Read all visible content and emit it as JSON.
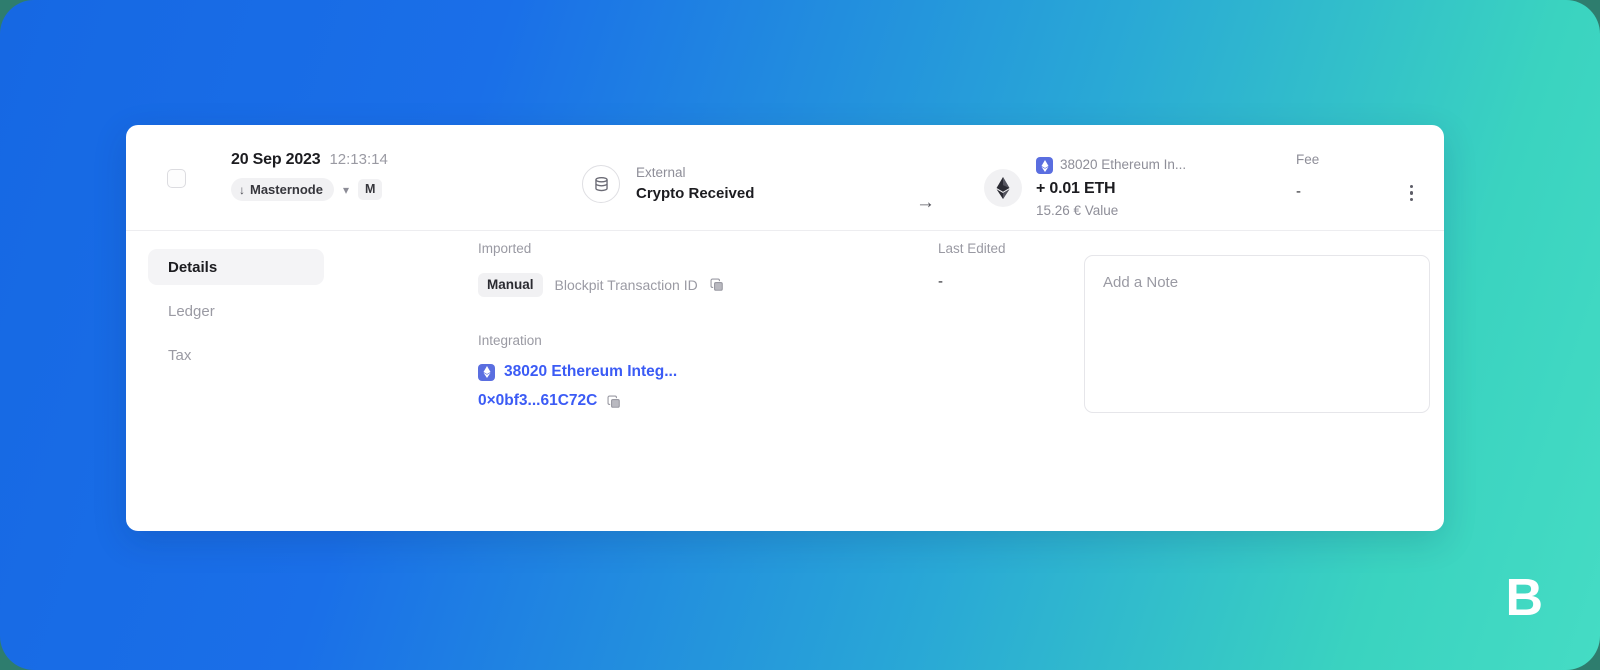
{
  "theme": {
    "gradient_start": "#1668e3",
    "gradient_end": "#45dcc4",
    "card_bg": "#ffffff",
    "link_color": "#3b5bf5",
    "eth_badge_color": "#5a6ee0",
    "muted_text": "#9a9aa3"
  },
  "brand": {
    "logo_letter": "B"
  },
  "transaction": {
    "date": "20 Sep 2023",
    "time": "12:13:14",
    "label_pill": "Masternode",
    "label_badge": "M",
    "source_type": "External",
    "operation": "Crypto Received",
    "direction_arrow": "→",
    "asset_source": "38020 Ethereum In...",
    "amount": "+ 0.01 ETH",
    "fiat_value": "15.26 € Value",
    "fee_label": "Fee",
    "fee_value": "-"
  },
  "tabs": [
    {
      "label": "Details",
      "active": true
    },
    {
      "label": "Ledger",
      "active": false
    },
    {
      "label": "Tax",
      "active": false
    }
  ],
  "details": {
    "imported": {
      "label": "Imported",
      "chip": "Manual",
      "transaction_id_label": "Blockpit Transaction ID"
    },
    "integration": {
      "label": "Integration",
      "name": "38020 Ethereum Integ...",
      "address": "0×0bf3...61C72C"
    },
    "last_edited": {
      "label": "Last Edited",
      "value": "-"
    },
    "note": {
      "placeholder": "Add a Note",
      "value": ""
    }
  },
  "icons": {
    "checkbox": "checkbox-unchecked-icon",
    "external_source": "database-stack-icon",
    "coin": "ethereum-icon",
    "menu": "more-vertical-icon",
    "copy": "copy-icon",
    "chevron": "chevron-down-icon",
    "arrow_down": "arrow-down-icon"
  }
}
